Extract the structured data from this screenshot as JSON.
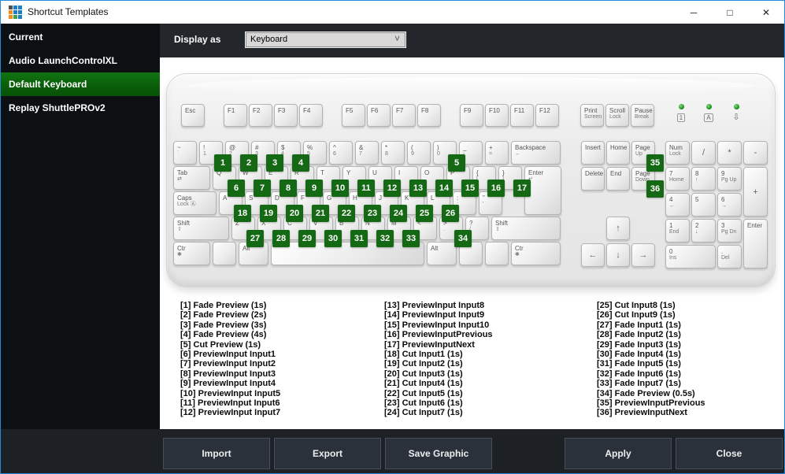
{
  "window": {
    "title": "Shortcut Templates",
    "controls": {
      "minimize": "─",
      "maximize": "□",
      "close": "✕"
    },
    "border_color": "#2489dc",
    "icon_colors": [
      "#4d4f52",
      "#1e7fc4",
      "#1e7fc4",
      "#ef8d1e",
      "#1e7fc4",
      "#1e7fc4",
      "#ef8d1e",
      "#43a047",
      "#1e7fc4"
    ]
  },
  "sidebar": {
    "items": [
      "Current",
      "Audio LaunchControlXL",
      "Default Keyboard",
      "Replay ShuttlePROv2"
    ],
    "selected": "Default Keyboard",
    "selected_index": 2,
    "selected_color": "#0c6e0c"
  },
  "toolbar": {
    "label": "Display as",
    "value": "Keyboard"
  },
  "keyboard": {
    "badge_color": "#156915",
    "esc": {
      "id": "esc",
      "label": "Esc"
    },
    "function_groups": [
      [
        {
          "label": "F1"
        },
        {
          "label": "F2"
        },
        {
          "label": "F3"
        },
        {
          "label": "F4"
        }
      ],
      [
        {
          "label": "F5"
        },
        {
          "label": "F6"
        },
        {
          "label": "F7"
        },
        {
          "label": "F8"
        }
      ],
      [
        {
          "label": "F9"
        },
        {
          "label": "F10"
        },
        {
          "label": "F11"
        },
        {
          "label": "F12"
        }
      ]
    ],
    "system_keys": [
      {
        "label": "Print",
        "sub": "Screen"
      },
      {
        "label": "Scroll",
        "sub": "Lock"
      },
      {
        "label": "Pause",
        "sub": "Break"
      }
    ],
    "leds": [
      {
        "symbol": "1",
        "boxed": true
      },
      {
        "symbol": "A",
        "boxed": true
      },
      {
        "symbol": "⇩",
        "boxed": false
      }
    ],
    "main_rows": [
      [
        {
          "label": "~",
          "sub": "`"
        },
        {
          "id": "d1",
          "label": "!",
          "sub": "1"
        },
        {
          "id": "d2",
          "label": "@",
          "sub": "2"
        },
        {
          "id": "d3",
          "label": "#",
          "sub": "3"
        },
        {
          "id": "d4",
          "label": "$",
          "sub": "4"
        },
        {
          "label": "%",
          "sub": "5"
        },
        {
          "label": "^",
          "sub": "6"
        },
        {
          "label": "&",
          "sub": "7"
        },
        {
          "label": "*",
          "sub": "8"
        },
        {
          "label": "(",
          "sub": "9"
        },
        {
          "id": "d0",
          "label": ")",
          "sub": "0"
        },
        {
          "label": "_",
          "sub": "-"
        },
        {
          "label": "+",
          "sub": "="
        },
        {
          "label": "Backspace",
          "sub": "←",
          "w": 2
        }
      ],
      [
        {
          "label": "Tab",
          "sub": "⇄",
          "w": 1.5
        },
        {
          "id": "q",
          "label": "Q"
        },
        {
          "id": "w",
          "label": "W"
        },
        {
          "id": "e",
          "label": "E"
        },
        {
          "id": "r",
          "label": "R"
        },
        {
          "id": "t",
          "label": "T"
        },
        {
          "id": "y",
          "label": "Y"
        },
        {
          "id": "u",
          "label": "U"
        },
        {
          "id": "i",
          "label": "I"
        },
        {
          "id": "o",
          "label": "O"
        },
        {
          "id": "p",
          "label": "P"
        },
        {
          "id": "lbracket",
          "label": "{",
          "sub": "["
        },
        {
          "id": "rbracket",
          "label": "}",
          "sub": "]"
        },
        {
          "id": "enter",
          "label": "Enter",
          "sub": "↵",
          "w": 1.5,
          "h": 2
        }
      ],
      [
        {
          "label": "Caps",
          "sub": "Lock Ⓐ",
          "w": 1.75
        },
        {
          "id": "a",
          "label": "A"
        },
        {
          "id": "s",
          "label": "S"
        },
        {
          "id": "dk",
          "label": "D"
        },
        {
          "id": "f",
          "label": "F"
        },
        {
          "id": "g",
          "label": "G"
        },
        {
          "id": "h",
          "label": "H"
        },
        {
          "id": "j",
          "label": "J"
        },
        {
          "id": "k",
          "label": "K"
        },
        {
          "id": "l",
          "label": "L"
        },
        {
          "label": ":",
          "sub": ";"
        },
        {
          "label": "\"",
          "sub": "'"
        }
      ],
      [
        {
          "label": "Shift",
          "sub": "⇧",
          "w": 2.25
        },
        {
          "id": "z",
          "label": "Z"
        },
        {
          "id": "x",
          "label": "X"
        },
        {
          "id": "c",
          "label": "C"
        },
        {
          "id": "v",
          "label": "V"
        },
        {
          "id": "b",
          "label": "B"
        },
        {
          "id": "n",
          "label": "N"
        },
        {
          "id": "m",
          "label": "M"
        },
        {
          "label": "<",
          "sub": ","
        },
        {
          "id": "period",
          "label": ">",
          "sub": "."
        },
        {
          "label": "?",
          "sub": "/"
        },
        {
          "label": "Shift",
          "sub": "⇧",
          "w": 2.75
        }
      ],
      [
        {
          "label": "Ctr",
          "sub": "✱",
          "w": 1.5
        },
        {
          "label": "",
          "w": 1
        },
        {
          "label": "Alt",
          "w": 1.25
        },
        {
          "id": "space",
          "label": "",
          "w": 6
        },
        {
          "label": "Alt",
          "w": 1.25
        },
        {
          "label": "",
          "w": 1
        },
        {
          "label": "",
          "w": 1
        },
        {
          "label": "Ctr",
          "sub": "✱",
          "w": 2
        }
      ]
    ],
    "nav_keys": [
      {
        "label": "Insert"
      },
      {
        "label": "Home"
      },
      {
        "id": "pgup",
        "label": "Page",
        "sub": "Up"
      },
      {
        "label": "Delete"
      },
      {
        "label": "End"
      },
      {
        "id": "pgdn",
        "label": "Page",
        "sub": "Down"
      }
    ],
    "arrow_keys": [
      {
        "label": "↑",
        "c": 1
      },
      {
        "label": "←",
        "c": 1
      },
      {
        "label": "↓",
        "c": 1
      },
      {
        "label": "→",
        "c": 1
      }
    ],
    "numpad_rows": [
      [
        {
          "col": 0,
          "label": "Num",
          "sub": "Lock"
        },
        {
          "col": 1,
          "label": "/",
          "c": 1
        },
        {
          "col": 2,
          "label": "*",
          "c": 1
        },
        {
          "col": 3,
          "label": "-",
          "c": 1
        }
      ],
      [
        {
          "col": 0,
          "label": "7",
          "sub": "Home"
        },
        {
          "col": 1,
          "label": "8",
          "sub": "↑"
        },
        {
          "col": 2,
          "label": "9",
          "sub": "Pg Up"
        },
        {
          "col": 3,
          "label": "+",
          "c": 1,
          "h": 2
        }
      ],
      [
        {
          "col": 0,
          "label": "4",
          "sub": "←"
        },
        {
          "col": 1,
          "label": "5"
        },
        {
          "col": 2,
          "label": "6",
          "sub": "→"
        }
      ],
      [
        {
          "col": 0,
          "label": "1",
          "sub": "End"
        },
        {
          "col": 1,
          "label": "2",
          "sub": "↓"
        },
        {
          "col": 2,
          "label": "3",
          "sub": "Pg Dn"
        },
        {
          "col": 3,
          "label": "Enter",
          "h": 2
        }
      ],
      [
        {
          "col": 0,
          "label": "0",
          "sub": "Ins",
          "w": 2
        },
        {
          "col": 2,
          "label": ".",
          "sub": "Del"
        }
      ]
    ],
    "badges": [
      {
        "n": "1",
        "key": "d1"
      },
      {
        "n": "2",
        "key": "d2"
      },
      {
        "n": "3",
        "key": "d3"
      },
      {
        "n": "4",
        "key": "d4"
      },
      {
        "n": "5",
        "key": "d0"
      },
      {
        "n": "6",
        "key": "q"
      },
      {
        "n": "7",
        "key": "w"
      },
      {
        "n": "8",
        "key": "e"
      },
      {
        "n": "9",
        "key": "r"
      },
      {
        "n": "10",
        "key": "t"
      },
      {
        "n": "11",
        "key": "y"
      },
      {
        "n": "12",
        "key": "u"
      },
      {
        "n": "13",
        "key": "i"
      },
      {
        "n": "14",
        "key": "o"
      },
      {
        "n": "15",
        "key": "p"
      },
      {
        "n": "16",
        "key": "lbracket"
      },
      {
        "n": "17",
        "key": "rbracket"
      },
      {
        "n": "18",
        "key": "a"
      },
      {
        "n": "19",
        "key": "s"
      },
      {
        "n": "20",
        "key": "dk"
      },
      {
        "n": "21",
        "key": "f"
      },
      {
        "n": "22",
        "key": "g"
      },
      {
        "n": "23",
        "key": "h"
      },
      {
        "n": "24",
        "key": "j"
      },
      {
        "n": "25",
        "key": "k"
      },
      {
        "n": "26",
        "key": "l"
      },
      {
        "n": "27",
        "key": "z"
      },
      {
        "n": "28",
        "key": "x"
      },
      {
        "n": "29",
        "key": "c"
      },
      {
        "n": "30",
        "key": "v"
      },
      {
        "n": "31",
        "key": "b"
      },
      {
        "n": "32",
        "key": "n"
      },
      {
        "n": "33",
        "key": "m"
      },
      {
        "n": "34",
        "key": "period"
      },
      {
        "n": "35",
        "key": "pgup"
      },
      {
        "n": "36",
        "key": "pgdn"
      }
    ]
  },
  "shortcuts": {
    "columns": [
      [
        "[1] Fade Preview (1s)",
        "[2] Fade Preview (2s)",
        "[3] Fade Preview (3s)",
        "[4] Fade Preview (4s)",
        "[5] Cut Preview (1s)",
        "[6] PreviewInput Input1",
        "[7] PreviewInput Input2",
        "[8] PreviewInput Input3",
        "[9] PreviewInput Input4",
        "[10] PreviewInput Input5",
        "[11] PreviewInput Input6",
        "[12] PreviewInput Input7"
      ],
      [
        "[13] PreviewInput Input8",
        "[14] PreviewInput Input9",
        "[15] PreviewInput Input10",
        "[16] PreviewInputPrevious",
        "[17] PreviewInputNext",
        "[18] Cut Input1 (1s)",
        "[19] Cut Input2 (1s)",
        "[20] Cut Input3 (1s)",
        "[21] Cut Input4 (1s)",
        "[22] Cut Input5 (1s)",
        "[23] Cut Input6 (1s)",
        "[24] Cut Input7 (1s)"
      ],
      [
        "[25] Cut Input8 (1s)",
        "[26] Cut Input9 (1s)",
        "[27] Fade Input1 (1s)",
        "[28] Fade Input2 (1s)",
        "[29] Fade Input3 (1s)",
        "[30] Fade Input4 (1s)",
        "[31] Fade Input5 (1s)",
        "[32] Fade Input6 (1s)",
        "[33] Fade Input7 (1s)",
        "[34] Fade Preview (0.5s)",
        "[35] PreviewInputPrevious",
        "[36] PreviewInputNext"
      ]
    ]
  },
  "footer": {
    "buttons": [
      "Import",
      "Export",
      "Save Graphic",
      "Apply",
      "Close"
    ]
  }
}
